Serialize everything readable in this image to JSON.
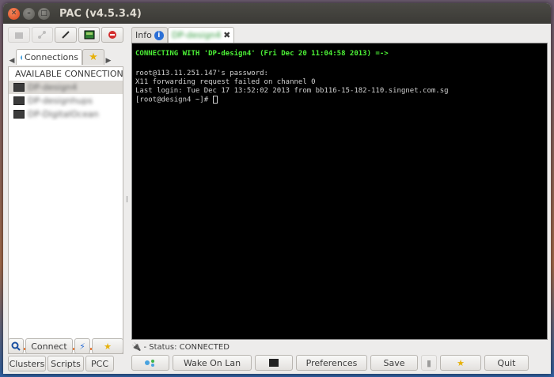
{
  "window": {
    "title": "PAC (v4.5.3.4)"
  },
  "left": {
    "tabs": [
      {
        "label": "Connections"
      }
    ],
    "tree": {
      "root": "AVAILABLE CONNECTIONS",
      "items": [
        {
          "label": "DP-design4"
        },
        {
          "label": "DP-designhups"
        },
        {
          "label": "DP-DigitalOcean"
        }
      ]
    },
    "buttons": {
      "connect": "Connect",
      "clusters": "Clusters",
      "scripts": "Scripts",
      "pcc": "PCC"
    }
  },
  "right": {
    "tabs": [
      {
        "label": "Info"
      },
      {
        "label": "DP-design4"
      }
    ],
    "terminal": {
      "header": "CONNECTING WITH 'DP-design4' (Fri Dec 20 11:04:58 2013) =->",
      "lines": [
        "root@113.11.251.147's password:",
        "X11 forwarding request failed on channel 0",
        "Last login: Tue Dec 17 13:52:02 2013 from bb116-15-182-110.singnet.com.sg",
        "[root@design4 ~]# "
      ]
    },
    "status": "- Status: CONNECTED",
    "buttons": {
      "wake": "Wake On Lan",
      "preferences": "Preferences",
      "save": "Save",
      "quit": "Quit"
    }
  },
  "colors": {
    "accent": "#4cf036",
    "close": "#d9441a",
    "progress": "#e8803f"
  }
}
